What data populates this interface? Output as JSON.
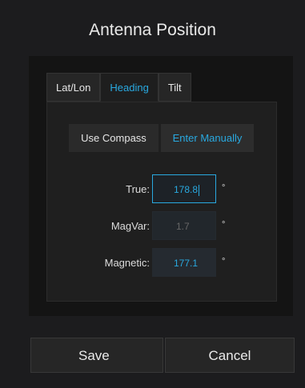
{
  "dialog": {
    "title": "Antenna Position"
  },
  "tabs": [
    {
      "label": "Lat/Lon",
      "active": false
    },
    {
      "label": "Heading",
      "active": true
    },
    {
      "label": "Tilt",
      "active": false
    }
  ],
  "mode": {
    "compass_label": "Use Compass",
    "manual_label": "Enter Manually",
    "selected": "Enter Manually"
  },
  "fields": {
    "true": {
      "label": "True:",
      "value": "178.8",
      "unit": "°",
      "focused": true
    },
    "magvar": {
      "label": "MagVar:",
      "value": "1.7",
      "unit": "°",
      "disabled": true
    },
    "magnetic": {
      "label": "Magnetic:",
      "value": "177.1",
      "unit": "°"
    }
  },
  "actions": {
    "save_label": "Save",
    "cancel_label": "Cancel"
  },
  "colors": {
    "accent": "#29a9e0",
    "background": "#1c1c1e",
    "panel": "#141414"
  }
}
